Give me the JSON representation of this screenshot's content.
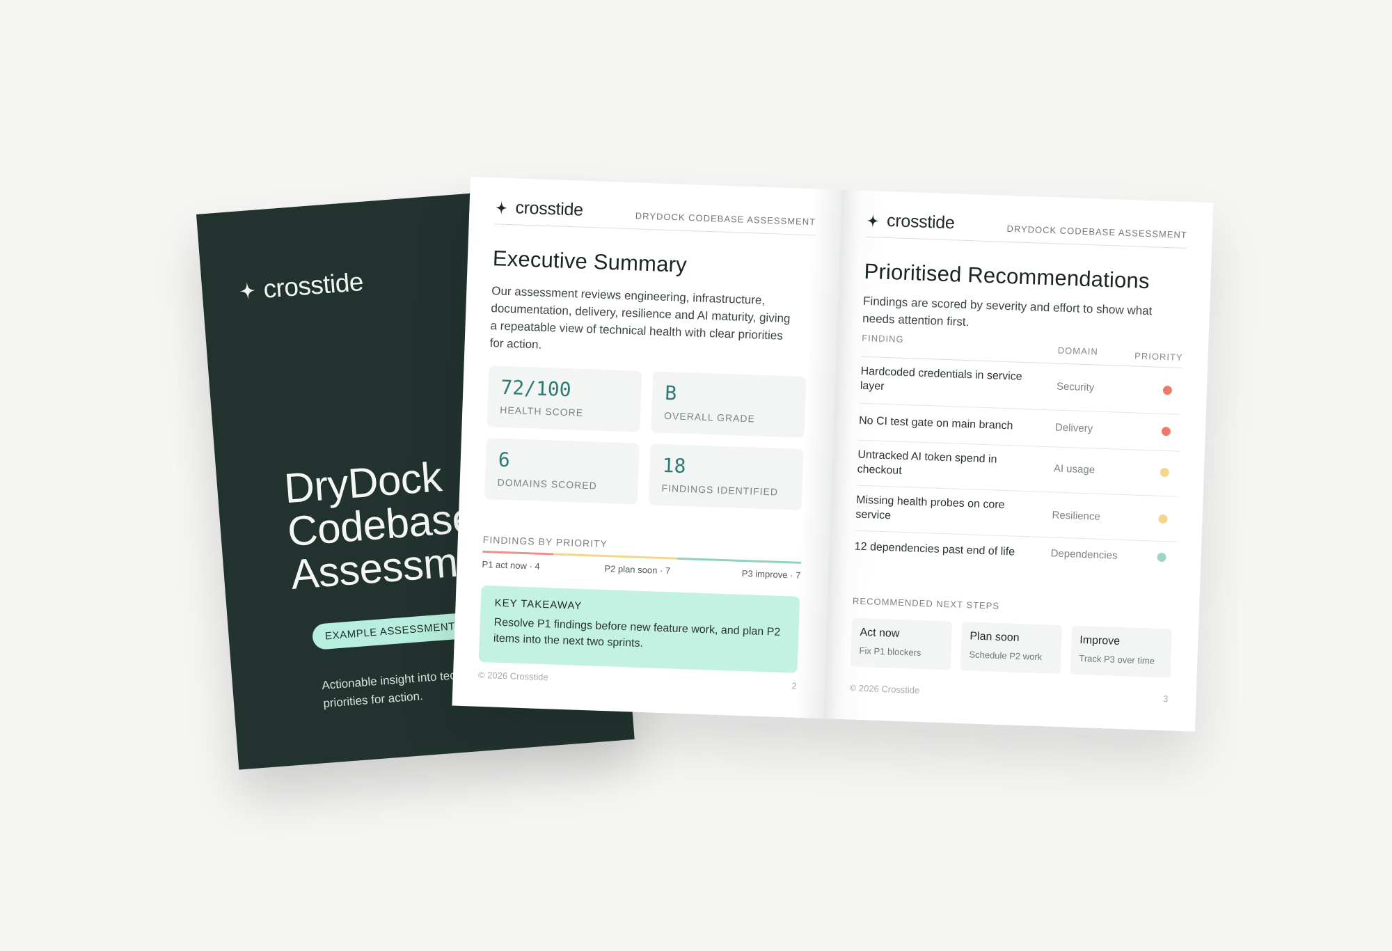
{
  "brand": {
    "name": "crosstide"
  },
  "cover": {
    "title_lines": [
      "DryDock",
      "Codebase",
      "Assessment"
    ],
    "badge": "EXAMPLE ASSESSMENT OUTPUT",
    "description": "Actionable insight into technical health and AI usage, with clear priorities for action."
  },
  "page2": {
    "header_label": "DRYDOCK CODEBASE ASSESSMENT",
    "title": "Executive Summary",
    "intro": "Our assessment reviews engineering, infrastructure, documentation, delivery, resilience and AI maturity, giving a repeatable view of technical health with clear priorities for action.",
    "metrics": [
      {
        "value": "72/100",
        "label": "HEALTH SCORE"
      },
      {
        "value": "B",
        "label": "OVERALL GRADE"
      },
      {
        "value": "6",
        "label": "DOMAINS SCORED"
      },
      {
        "value": "18",
        "label": "FINDINGS IDENTIFIED"
      }
    ],
    "findings_by_priority": {
      "label": "FINDINGS BY PRIORITY",
      "p1": "P1 act now · 4",
      "p2": "P2 plan soon · 7",
      "p3": "P3 improve · 7",
      "counts": [
        4,
        7,
        7
      ],
      "colors": [
        "#ee9090",
        "#f3d68a",
        "#8fd2c3"
      ]
    },
    "takeaway": {
      "title": "KEY TAKEAWAY",
      "body": "Resolve P1 findings before new feature work, and plan P2 items into the next two sprints."
    },
    "footer": "© 2026 Crosstide",
    "page_number": "2"
  },
  "page3": {
    "header_label": "DRYDOCK CODEBASE ASSESSMENT",
    "title": "Prioritised Recommendations",
    "intro": "Findings are scored by severity and effort to show what needs attention first.",
    "table": {
      "headers": {
        "finding": "FINDING",
        "domain": "DOMAIN",
        "priority": "PRIORITY"
      },
      "rows": [
        {
          "finding": "Hardcoded credentials in service layer",
          "domain": "Security",
          "priority_color": "#ee7a68"
        },
        {
          "finding": "No CI test gate on main branch",
          "domain": "Delivery",
          "priority_color": "#ee7a68"
        },
        {
          "finding": "Untracked AI token spend in checkout",
          "domain": "AI usage",
          "priority_color": "#f6d58e"
        },
        {
          "finding": "Missing health probes on core service",
          "domain": "Resilience",
          "priority_color": "#f6d58e"
        },
        {
          "finding": "12 dependencies past end of life",
          "domain": "Dependencies",
          "priority_color": "#9fd5c9"
        }
      ]
    },
    "next_steps": {
      "label": "RECOMMENDED NEXT STEPS",
      "items": [
        {
          "title": "Act now",
          "sub": "Fix P1 blockers"
        },
        {
          "title": "Plan soon",
          "sub": "Schedule P2 work"
        },
        {
          "title": "Improve",
          "sub": "Track P3 over time"
        }
      ]
    },
    "footer": "© 2026 Crosstide",
    "page_number": "3"
  }
}
